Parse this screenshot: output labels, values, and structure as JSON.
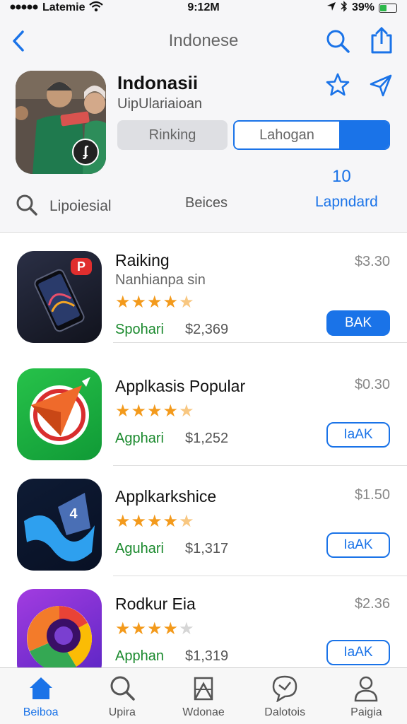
{
  "status": {
    "carrier": "Latemie",
    "time": "9:12M",
    "battery": "39%",
    "battery_level": 0.39
  },
  "nav": {
    "title": "Indonese"
  },
  "header": {
    "title": "Indonasii",
    "subtitle": "UipUlariaioan",
    "segment_ranking": "Rinking",
    "segment_language": "Lahogan",
    "search_label": "Lipoiesial",
    "basics_label": "Beices",
    "count": "10",
    "leaderboard_link": "Lapndard"
  },
  "apps": [
    {
      "name": "Raiking",
      "subtitle": "Nanhianpa sin",
      "rating": 4.5,
      "tag": "Spohari",
      "count": "$2,369",
      "price": "$3.30",
      "button": "BAK",
      "button_style": "filled",
      "icon": "phone-icon"
    },
    {
      "name": "Applkasis Popular",
      "subtitle": "",
      "rating": 4.5,
      "tag": "Agphari",
      "count": "$1,252",
      "price": "$0.30",
      "button": "IaAK",
      "button_style": "outline",
      "icon": "compass-icon"
    },
    {
      "name": "Applkarkshice",
      "subtitle": "",
      "rating": 4.5,
      "tag": "Aguhari",
      "count": "$1,317",
      "price": "$1.50",
      "button": "IaAK",
      "button_style": "outline",
      "icon": "wave-icon"
    },
    {
      "name": "Rodkur Eia",
      "subtitle": "",
      "rating": 4,
      "tag": "Apphan",
      "count": "$1,319",
      "price": "$2.36",
      "button": "IaAK",
      "button_style": "outline",
      "icon": "chrome-icon"
    }
  ],
  "tabs": [
    {
      "label": "Beiboa",
      "icon": "home-icon",
      "active": true
    },
    {
      "label": "Upira",
      "icon": "search-icon",
      "active": false
    },
    {
      "label": "Wdonae",
      "icon": "layers-icon",
      "active": false
    },
    {
      "label": "Dalotois",
      "icon": "chat-icon",
      "active": false
    },
    {
      "label": "Paigia",
      "icon": "person-icon",
      "active": false
    }
  ],
  "colors": {
    "accent": "#1a73e8",
    "star": "#f39a1c",
    "tag_green": "#1b8a2e"
  }
}
